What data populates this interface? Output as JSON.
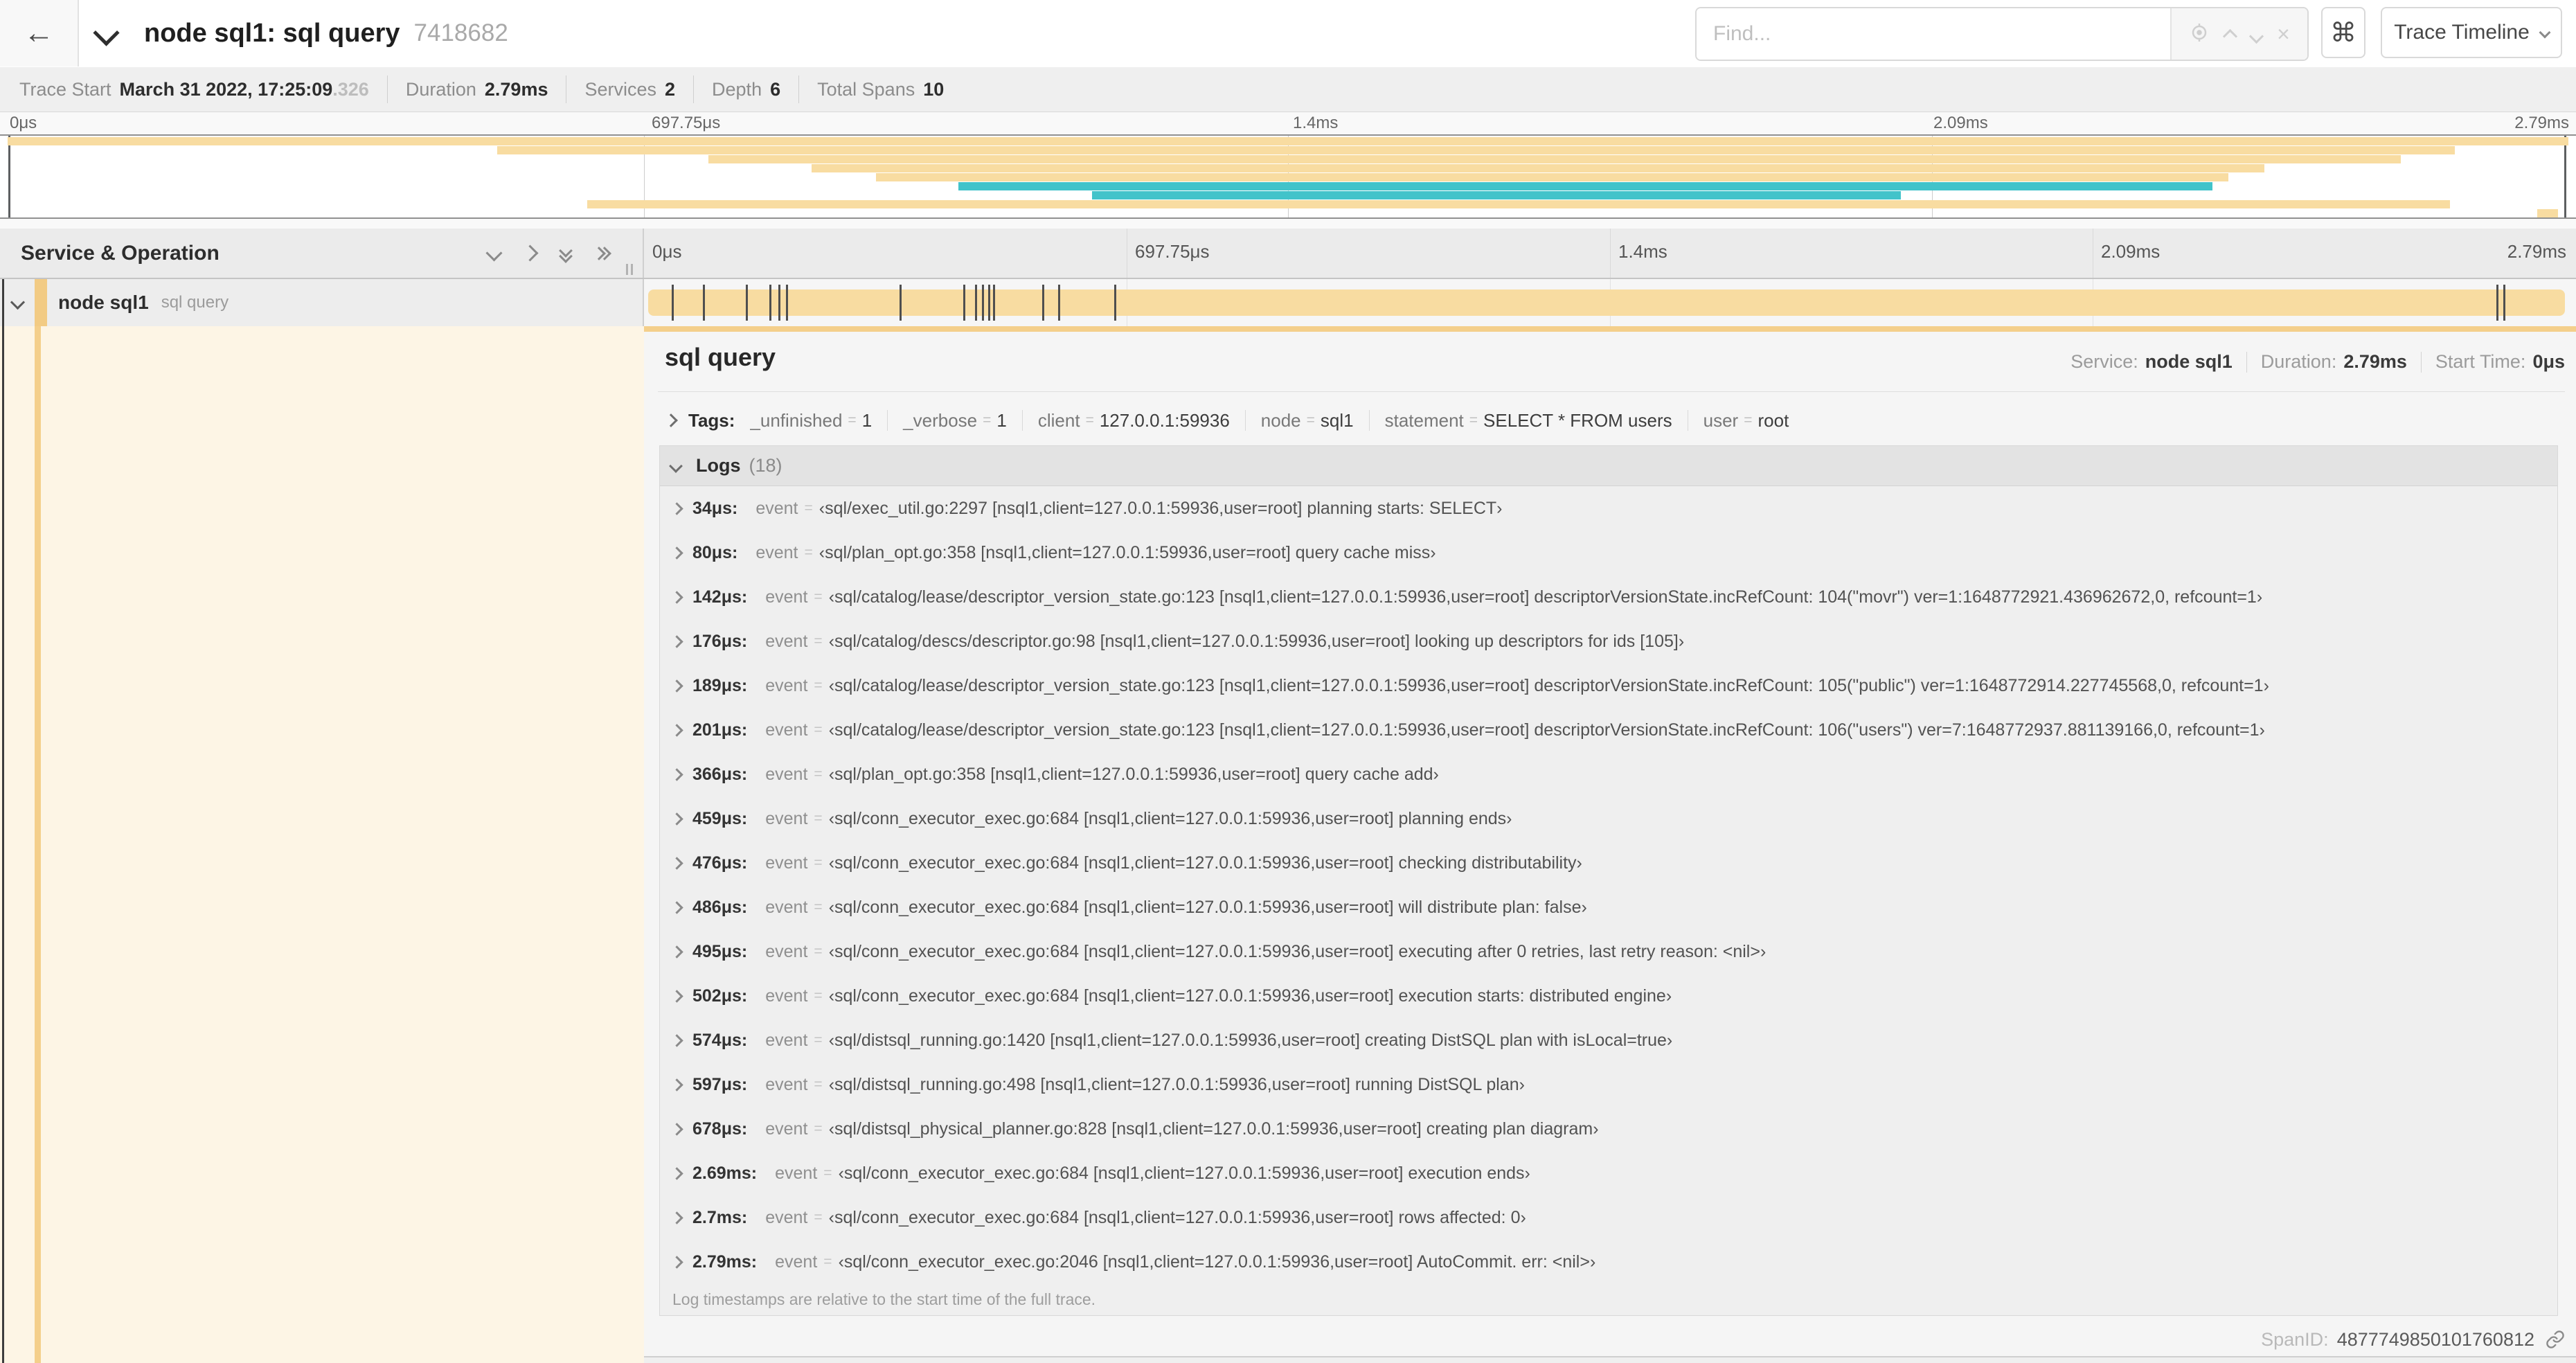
{
  "header": {
    "back": "←",
    "title": "node sql1: sql query",
    "trace_id": "7418682",
    "find_placeholder": "Find...",
    "clear_icon": "×",
    "command_key": "⌘",
    "view_select": "Trace Timeline"
  },
  "infobar": {
    "items": [
      {
        "label": "Trace Start",
        "value": "March 31 2022, 17:25:09",
        "suffix": ".326"
      },
      {
        "label": "Duration",
        "value": "2.79ms",
        "suffix": ""
      },
      {
        "label": "Services",
        "value": "2",
        "suffix": ""
      },
      {
        "label": "Depth",
        "value": "6",
        "suffix": ""
      },
      {
        "label": "Total Spans",
        "value": "10",
        "suffix": ""
      }
    ]
  },
  "minimap": {
    "ticks": [
      "0μs",
      "697.75μs",
      "1.4ms",
      "2.09ms",
      "2.79ms"
    ],
    "rows": [
      {
        "start": 0.3,
        "end": 99.7,
        "color": "tan"
      },
      {
        "start": 19.3,
        "end": 95.3,
        "color": "tan"
      },
      {
        "start": 27.5,
        "end": 93.2,
        "color": "tan"
      },
      {
        "start": 31.5,
        "end": 87.9,
        "color": "tan"
      },
      {
        "start": 34.0,
        "end": 86.5,
        "color": "tan"
      },
      {
        "start": 37.2,
        "end": 85.9,
        "color": "teal"
      },
      {
        "start": 42.4,
        "end": 73.8,
        "color": "teal"
      },
      {
        "start": 22.8,
        "end": 95.1,
        "color": "tan"
      },
      {
        "start": 98.5,
        "end": 99.3,
        "color": "tan"
      }
    ]
  },
  "timeline": {
    "column_title": "Service & Operation",
    "ticks": [
      "0μs",
      "697.75μs",
      "1.4ms",
      "2.09ms",
      "2.79ms"
    ],
    "row": {
      "service": "node sql1",
      "operation": "sql query"
    },
    "total_us": 2790,
    "markers_us": [
      34,
      80,
      142,
      176,
      189,
      201,
      366,
      459,
      476,
      486,
      495,
      502,
      574,
      597,
      678,
      2690,
      2700
    ]
  },
  "detail": {
    "title": "sql query",
    "meta": [
      {
        "label": "Service:",
        "value": "node sql1"
      },
      {
        "label": "Duration:",
        "value": "2.79ms"
      },
      {
        "label": "Start Time:",
        "value": "0μs"
      }
    ],
    "tags_label": "Tags:",
    "tags": [
      {
        "key": "_unfinished",
        "value": "1"
      },
      {
        "key": "_verbose",
        "value": "1"
      },
      {
        "key": "client",
        "value": "127.0.0.1:59936"
      },
      {
        "key": "node",
        "value": "sql1"
      },
      {
        "key": "statement",
        "value": "SELECT * FROM users"
      },
      {
        "key": "user",
        "value": "root"
      }
    ],
    "logs_label": "Logs",
    "logs_count": "(18)",
    "logs": [
      {
        "t": "34μs:",
        "key": "event",
        "value": "‹sql/exec_util.go:2297 [nsql1,client=127.0.0.1:59936,user=root] planning starts: SELECT›"
      },
      {
        "t": "80μs:",
        "key": "event",
        "value": "‹sql/plan_opt.go:358 [nsql1,client=127.0.0.1:59936,user=root] query cache miss›"
      },
      {
        "t": "142μs:",
        "key": "event",
        "value": "‹sql/catalog/lease/descriptor_version_state.go:123 [nsql1,client=127.0.0.1:59936,user=root] descriptorVersionState.incRefCount: 104(\"movr\") ver=1:1648772921.436962672,0, refcount=1›"
      },
      {
        "t": "176μs:",
        "key": "event",
        "value": "‹sql/catalog/descs/descriptor.go:98 [nsql1,client=127.0.0.1:59936,user=root] looking up descriptors for ids [105]›"
      },
      {
        "t": "189μs:",
        "key": "event",
        "value": "‹sql/catalog/lease/descriptor_version_state.go:123 [nsql1,client=127.0.0.1:59936,user=root] descriptorVersionState.incRefCount: 105(\"public\") ver=1:1648772914.227745568,0, refcount=1›"
      },
      {
        "t": "201μs:",
        "key": "event",
        "value": "‹sql/catalog/lease/descriptor_version_state.go:123 [nsql1,client=127.0.0.1:59936,user=root] descriptorVersionState.incRefCount: 106(\"users\") ver=7:1648772937.881139166,0, refcount=1›"
      },
      {
        "t": "366μs:",
        "key": "event",
        "value": "‹sql/plan_opt.go:358 [nsql1,client=127.0.0.1:59936,user=root] query cache add›"
      },
      {
        "t": "459μs:",
        "key": "event",
        "value": "‹sql/conn_executor_exec.go:684 [nsql1,client=127.0.0.1:59936,user=root] planning ends›"
      },
      {
        "t": "476μs:",
        "key": "event",
        "value": "‹sql/conn_executor_exec.go:684 [nsql1,client=127.0.0.1:59936,user=root] checking distributability›"
      },
      {
        "t": "486μs:",
        "key": "event",
        "value": "‹sql/conn_executor_exec.go:684 [nsql1,client=127.0.0.1:59936,user=root] will distribute plan: false›"
      },
      {
        "t": "495μs:",
        "key": "event",
        "value": "‹sql/conn_executor_exec.go:684 [nsql1,client=127.0.0.1:59936,user=root] executing after 0 retries, last retry reason: <nil>›"
      },
      {
        "t": "502μs:",
        "key": "event",
        "value": "‹sql/conn_executor_exec.go:684 [nsql1,client=127.0.0.1:59936,user=root] execution starts: distributed engine›"
      },
      {
        "t": "574μs:",
        "key": "event",
        "value": "‹sql/distsql_running.go:1420 [nsql1,client=127.0.0.1:59936,user=root] creating DistSQL plan with isLocal=true›"
      },
      {
        "t": "597μs:",
        "key": "event",
        "value": "‹sql/distsql_running.go:498 [nsql1,client=127.0.0.1:59936,user=root] running DistSQL plan›"
      },
      {
        "t": "678μs:",
        "key": "event",
        "value": "‹sql/distsql_physical_planner.go:828 [nsql1,client=127.0.0.1:59936,user=root] creating plan diagram›"
      },
      {
        "t": "2.69ms:",
        "key": "event",
        "value": "‹sql/conn_executor_exec.go:684 [nsql1,client=127.0.0.1:59936,user=root] execution ends›"
      },
      {
        "t": "2.7ms:",
        "key": "event",
        "value": "‹sql/conn_executor_exec.go:684 [nsql1,client=127.0.0.1:59936,user=root] rows affected: 0›"
      },
      {
        "t": "2.79ms:",
        "key": "event",
        "value": "‹sql/conn_executor_exec.go:2046 [nsql1,client=127.0.0.1:59936,user=root] AutoCommit. err: <nil>›"
      }
    ],
    "note": "Log timestamps are relative to the start time of the full trace.",
    "span_id_label": "SpanID:",
    "span_id": "4877749850101760812"
  },
  "colors": {
    "tan": "#f8dca1",
    "teal": "#42c3ca",
    "accent_strip": "#f2cb84",
    "detail_strip": "#f4cf8b"
  }
}
